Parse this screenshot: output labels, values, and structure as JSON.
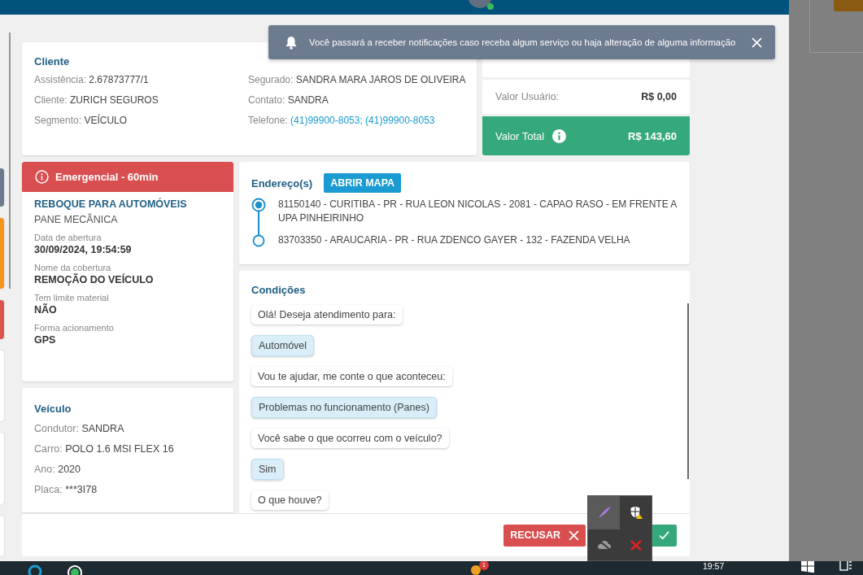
{
  "side_cards": [
    {
      "color": "#6b7a8f"
    },
    {
      "color": "#f7941d"
    },
    {
      "color": "#d9534f"
    },
    {
      "color": "#ffffff"
    },
    {
      "color": "#ffffff"
    },
    {
      "color": "#ffffff"
    }
  ],
  "client": {
    "title": "Cliente",
    "fields_left": [
      {
        "label": "Assistência:",
        "value": "2.67873777/1",
        "kind": "text"
      },
      {
        "label": "Cliente:",
        "value": "ZURICH SEGUROS",
        "kind": "text"
      },
      {
        "label": "Segmento:",
        "value": "VEÍCULO",
        "kind": "text"
      }
    ],
    "fields_right": [
      {
        "label": "Segurado:",
        "value": "SANDRA MARA JAROS DE OLIVEIRA",
        "kind": "text"
      },
      {
        "label": "Contato:",
        "value": "SANDRA",
        "kind": "text"
      },
      {
        "label": "Telefone:",
        "value": "(41)99900-8053; (41)99900-8053",
        "kind": "link"
      }
    ]
  },
  "values": {
    "rows": [
      {
        "label": "Valor Usuário:",
        "value": "R$ 0,00"
      }
    ],
    "total": {
      "label": "Valor Total",
      "value": "R$ 143,60"
    }
  },
  "service": {
    "priority": "Emergencial - 60min",
    "title": "REBOQUE PARA AUTOMÓVEIS",
    "subtitle": "PANE MECÂNICA",
    "details": [
      {
        "label": "Data de abertura",
        "value": "30/09/2024, 19:54:59"
      },
      {
        "label": "Nome da cobertura",
        "value": "REMOÇÃO DO VEÍCULO"
      },
      {
        "label": "Tem limite material",
        "value": "NÃO"
      },
      {
        "label": "Forma acionamento",
        "value": "GPS"
      }
    ]
  },
  "vehicle": {
    "title": "Veículo",
    "fields": [
      {
        "label": "Condutor:",
        "value": "SANDRA"
      },
      {
        "label": "Carro:",
        "value": "POLO 1.6 MSI FLEX 16"
      },
      {
        "label": "Ano:",
        "value": "2020"
      },
      {
        "label": "Placa:",
        "value": "***3I78"
      }
    ]
  },
  "addresses": {
    "title": "Endereço(s)",
    "button": "ABRIR MAPA",
    "stops": [
      {
        "kind": "origin",
        "text": "81150140 - CURITIBA - PR - RUA LEON NICOLAS - 2081 - CAPAO RASO - EM FRENTE A UPA PINHEIRINHO"
      },
      {
        "kind": "destination",
        "text": "83703350 - ARAUCARIA - PR - RUA ZDENCO GAYER - 132 - FAZENDA VELHA"
      }
    ]
  },
  "conditions": {
    "title": "Condições",
    "messages": [
      {
        "kind": "bot",
        "text": "Olá! Deseja atendimento para:"
      },
      {
        "kind": "user",
        "text": "Automóvel"
      },
      {
        "kind": "bot",
        "text": "Vou te ajudar, me conte o que aconteceu:"
      },
      {
        "kind": "user",
        "text": "Problemas no funcionamento (Panes)"
      },
      {
        "kind": "bot",
        "text": "Você sabe o que ocorreu com o veículo?"
      },
      {
        "kind": "user",
        "text": "Sim"
      },
      {
        "kind": "bot",
        "text": "O que houve?"
      }
    ]
  },
  "actions": [
    {
      "kind": "reject",
      "label": "RECUSAR"
    },
    {
      "kind": "accept"
    }
  ],
  "toast": {
    "text": "Você passará a receber notificações caso receba algum serviço ou haja alteração de alguma informação"
  },
  "taskbar": {
    "badge": "1",
    "time": "19:57"
  }
}
